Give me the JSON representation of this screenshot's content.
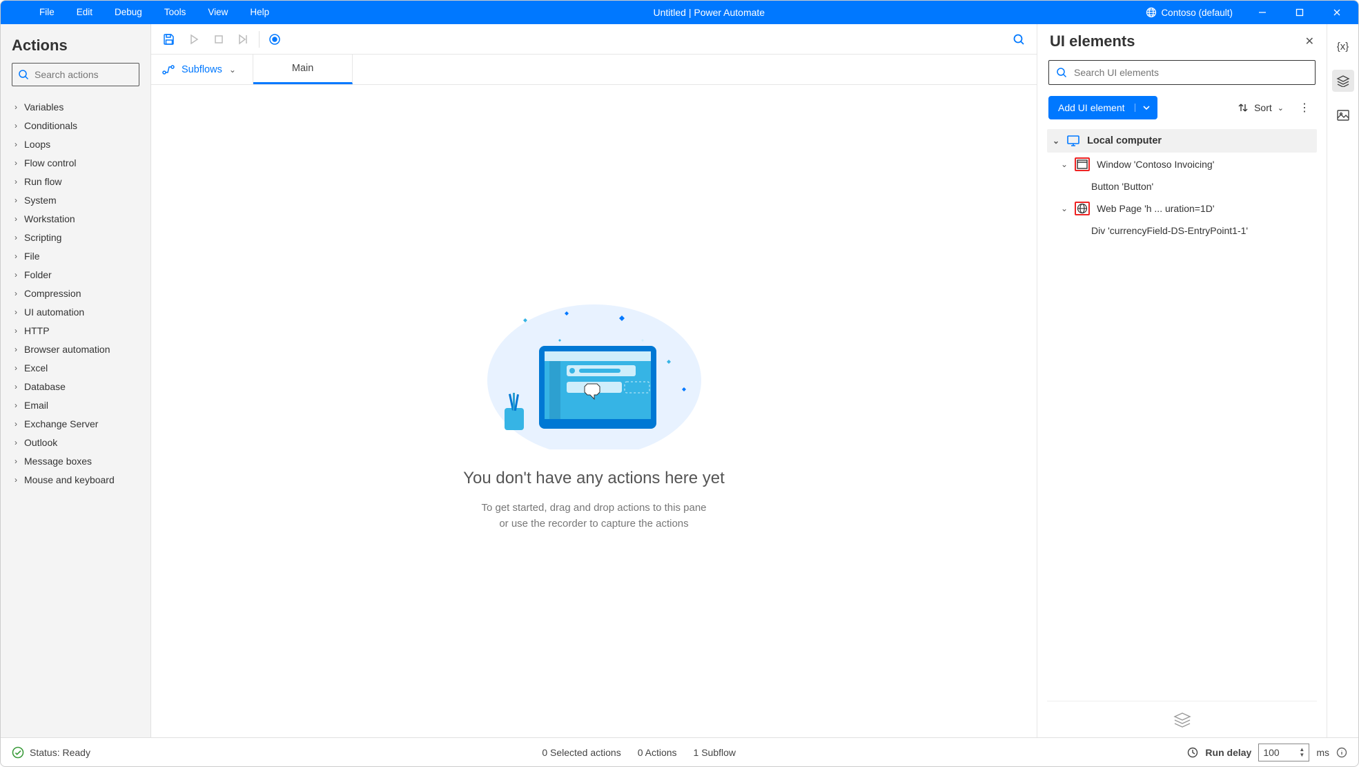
{
  "titlebar": {
    "menus": [
      "File",
      "Edit",
      "Debug",
      "Tools",
      "View",
      "Help"
    ],
    "title": "Untitled | Power Automate",
    "environment": "Contoso (default)"
  },
  "sidebar": {
    "title": "Actions",
    "search_placeholder": "Search actions",
    "categories": [
      "Variables",
      "Conditionals",
      "Loops",
      "Flow control",
      "Run flow",
      "System",
      "Workstation",
      "Scripting",
      "File",
      "Folder",
      "Compression",
      "UI automation",
      "HTTP",
      "Browser automation",
      "Excel",
      "Database",
      "Email",
      "Exchange Server",
      "Outlook",
      "Message boxes",
      "Mouse and keyboard"
    ]
  },
  "tabs": {
    "subflows_label": "Subflows",
    "main_tab": "Main"
  },
  "canvas": {
    "empty_title": "You don't have any actions here yet",
    "empty_sub1": "To get started, drag and drop actions to this pane",
    "empty_sub2": "or use the recorder to capture the actions"
  },
  "panel": {
    "title": "UI elements",
    "search_placeholder": "Search UI elements",
    "add_label": "Add UI element",
    "sort_label": "Sort",
    "root": "Local computer",
    "nodes": [
      {
        "icon": "window",
        "label": "Window 'Contoso Invoicing'",
        "child": "Button 'Button'"
      },
      {
        "icon": "globe",
        "label": "Web Page 'h ... uration=1D'",
        "child": "Div 'currencyField-DS-EntryPoint1-1'"
      }
    ]
  },
  "statusbar": {
    "status": "Status: Ready",
    "selected": "0 Selected actions",
    "actions": "0 Actions",
    "subflows": "1 Subflow",
    "run_delay_label": "Run delay",
    "run_delay_value": "100",
    "run_delay_unit": "ms"
  }
}
